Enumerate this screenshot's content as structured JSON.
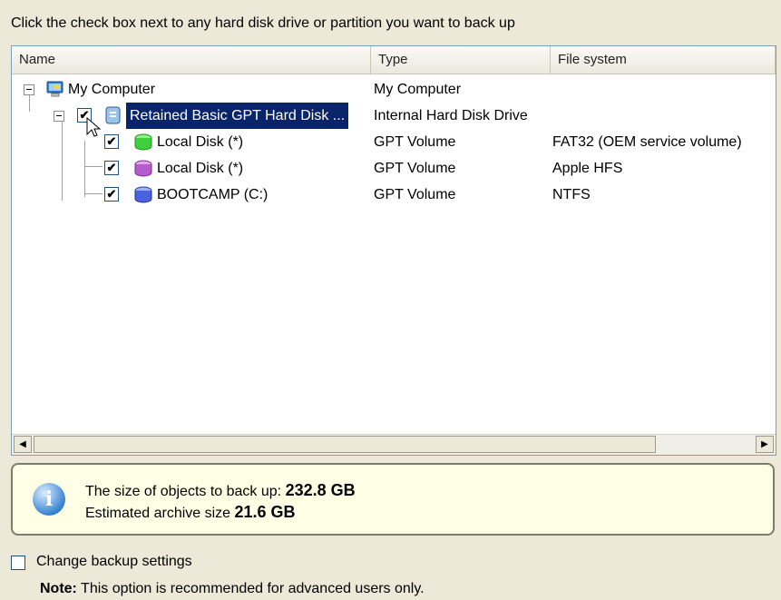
{
  "instruction": "Click the check box next to any hard disk drive or partition you want to back up",
  "columns": [
    "Name",
    "Type",
    "File system"
  ],
  "tree": {
    "root": {
      "name": "My Computer",
      "type": "My Computer",
      "fs": ""
    },
    "disk": {
      "name": "Retained Basic GPT Hard Disk ...",
      "type": "Internal Hard Disk Drive",
      "fs": "",
      "checked": true,
      "selected": true
    },
    "partitions": [
      {
        "name": "Local Disk (*)",
        "type": "GPT Volume",
        "fs": "FAT32 (OEM service volume)",
        "checked": true,
        "icon": "green-disk-icon"
      },
      {
        "name": "Local Disk (*)",
        "type": "GPT Volume",
        "fs": "Apple HFS",
        "checked": true,
        "icon": "purple-disk-icon"
      },
      {
        "name": "BOOTCAMP (C:)",
        "type": "GPT Volume",
        "fs": "NTFS",
        "checked": true,
        "icon": "blue-disk-icon"
      }
    ]
  },
  "info": {
    "size_label": "The size of objects to back up:",
    "size_value": "232.8 GB",
    "archive_label": "Estimated archive size",
    "archive_value": "21.6 GB"
  },
  "change_settings": {
    "label": "Change backup settings",
    "checked": false
  },
  "note": {
    "label": "Note:",
    "text": "This option is recommended for advanced users only."
  },
  "colors": {
    "selection": "#0a246a",
    "info_bg": "#ffffe5",
    "panel_bg": "#ece9d8"
  }
}
